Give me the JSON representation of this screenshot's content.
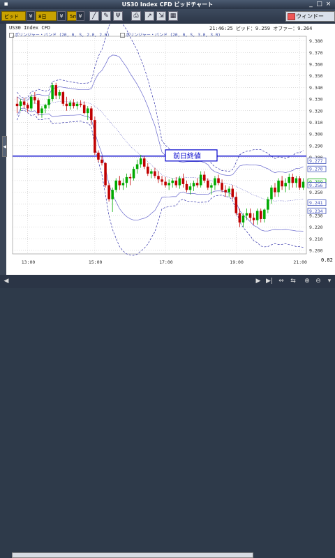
{
  "window": {
    "title": "US30 Index CFD ビッドチャート"
  },
  "toolbar": {
    "price_type": "ビッド",
    "period_count": "8日",
    "timeframe": "5m",
    "window_button": "ウィンドー"
  },
  "chart": {
    "symbol_label": "US30 Index CFD",
    "time": "21:46:25",
    "bid_label": "ビッド：9.259",
    "offer_label": "オファー：9.264",
    "legend1": "ボリンジャー・バンド (20, 0, S, 2.0, 2.0)",
    "legend2": "ボリンジャー・バンド (20, 0, S, 3.0, 3.0)",
    "prev_close_label": "前日終値",
    "zoom_readout": "0.82",
    "colors": {
      "up": "#00aa00",
      "down": "#c00000",
      "prev_close_line": "#0000cc",
      "band_inner": "#6666cc",
      "band_outer": "#3333aa"
    }
  },
  "chart_data": {
    "type": "candlestick",
    "x_ticks": [
      "13:00",
      "15:00",
      "17:00",
      "19:00",
      "21:00"
    ],
    "y_ticks": [
      "9.380",
      "9.370",
      "9.360",
      "9.350",
      "9.340",
      "9.330",
      "9.320",
      "9.310",
      "9.300",
      "9.290",
      "9.280",
      "9.270",
      "9.260",
      "9.250",
      "9.240",
      "9.230",
      "9.220",
      "9.210",
      "9.200"
    ],
    "ylim": [
      9.197,
      9.384
    ],
    "price_markers": [
      "9.277",
      "9.270",
      "9.259",
      "9.256",
      "9.241",
      "9.234"
    ],
    "prev_close": 9.281,
    "candles": [
      [
        9.326,
        9.332,
        9.318,
        9.324
      ],
      [
        9.324,
        9.33,
        9.32,
        9.328
      ],
      [
        9.328,
        9.331,
        9.322,
        9.325
      ],
      [
        9.325,
        9.327,
        9.319,
        9.322
      ],
      [
        9.322,
        9.334,
        9.32,
        9.332
      ],
      [
        9.332,
        9.336,
        9.326,
        9.329
      ],
      [
        9.329,
        9.331,
        9.316,
        9.318
      ],
      [
        9.318,
        9.324,
        9.314,
        9.322
      ],
      [
        9.322,
        9.326,
        9.318,
        9.325
      ],
      [
        9.325,
        9.333,
        9.322,
        9.33
      ],
      [
        9.33,
        9.344,
        9.328,
        9.342
      ],
      [
        9.342,
        9.344,
        9.33,
        9.333
      ],
      [
        9.333,
        9.338,
        9.33,
        9.336
      ],
      [
        9.336,
        9.337,
        9.324,
        9.326
      ],
      [
        9.326,
        9.332,
        9.32,
        9.324
      ],
      [
        9.324,
        9.329,
        9.321,
        9.327
      ],
      [
        9.327,
        9.33,
        9.322,
        9.324
      ],
      [
        9.324,
        9.328,
        9.321,
        9.326
      ],
      [
        9.326,
        9.329,
        9.323,
        9.325
      ],
      [
        9.325,
        9.328,
        9.317,
        9.318
      ],
      [
        9.318,
        9.324,
        9.312,
        9.322
      ],
      [
        9.322,
        9.324,
        9.308,
        9.312
      ],
      [
        9.312,
        9.315,
        9.282,
        9.284
      ],
      [
        9.284,
        9.286,
        9.276,
        9.278
      ],
      [
        9.278,
        9.281,
        9.273,
        9.275
      ],
      [
        9.275,
        9.276,
        9.254,
        9.256
      ],
      [
        9.256,
        9.258,
        9.242,
        9.244
      ],
      [
        9.244,
        9.254,
        9.233,
        9.252
      ],
      [
        9.252,
        9.262,
        9.25,
        9.26
      ],
      [
        9.26,
        9.264,
        9.252,
        9.256
      ],
      [
        9.256,
        9.262,
        9.252,
        9.258
      ],
      [
        9.258,
        9.266,
        9.254,
        9.263
      ],
      [
        9.263,
        9.266,
        9.256,
        9.262
      ],
      [
        9.262,
        9.272,
        9.26,
        9.27
      ],
      [
        9.27,
        9.278,
        9.266,
        9.274
      ],
      [
        9.274,
        9.282,
        9.271,
        9.279
      ],
      [
        9.279,
        9.281,
        9.27,
        9.272
      ],
      [
        9.272,
        9.275,
        9.264,
        9.266
      ],
      [
        9.266,
        9.27,
        9.262,
        9.268
      ],
      [
        9.268,
        9.271,
        9.262,
        9.264
      ],
      [
        9.264,
        9.268,
        9.258,
        9.261
      ],
      [
        9.261,
        9.264,
        9.256,
        9.259
      ],
      [
        9.259,
        9.263,
        9.254,
        9.256
      ],
      [
        9.256,
        9.261,
        9.252,
        9.258
      ],
      [
        9.258,
        9.262,
        9.254,
        9.26
      ],
      [
        9.26,
        9.263,
        9.254,
        9.256
      ],
      [
        9.256,
        9.264,
        9.253,
        9.262
      ],
      [
        9.262,
        9.266,
        9.254,
        9.257
      ],
      [
        9.257,
        9.26,
        9.25,
        9.252
      ],
      [
        9.252,
        9.258,
        9.248,
        9.255
      ],
      [
        9.255,
        9.26,
        9.251,
        9.258
      ],
      [
        9.258,
        9.262,
        9.254,
        9.256
      ],
      [
        9.256,
        9.268,
        9.254,
        9.265
      ],
      [
        9.265,
        9.268,
        9.258,
        9.26
      ],
      [
        9.26,
        9.262,
        9.252,
        9.254
      ],
      [
        9.254,
        9.258,
        9.248,
        9.256
      ],
      [
        9.256,
        9.264,
        9.252,
        9.262
      ],
      [
        9.262,
        9.265,
        9.256,
        9.258
      ],
      [
        9.258,
        9.261,
        9.25,
        9.252
      ],
      [
        9.252,
        9.256,
        9.246,
        9.25
      ],
      [
        9.25,
        9.255,
        9.246,
        9.253
      ],
      [
        9.253,
        9.256,
        9.244,
        9.246
      ],
      [
        9.246,
        9.25,
        9.23,
        9.232
      ],
      [
        9.232,
        9.236,
        9.22,
        9.224
      ],
      [
        9.224,
        9.232,
        9.22,
        9.23
      ],
      [
        9.23,
        9.236,
        9.226,
        9.232
      ],
      [
        9.232,
        9.236,
        9.225,
        9.228
      ],
      [
        9.228,
        9.232,
        9.222,
        9.226
      ],
      [
        9.226,
        9.236,
        9.222,
        9.234
      ],
      [
        9.234,
        9.236,
        9.224,
        9.227
      ],
      [
        9.227,
        9.236,
        9.224,
        9.235
      ],
      [
        9.235,
        9.246,
        9.232,
        9.244
      ],
      [
        9.244,
        9.256,
        9.24,
        9.254
      ],
      [
        9.254,
        9.258,
        9.246,
        9.25
      ],
      [
        9.25,
        9.262,
        9.246,
        9.26
      ],
      [
        9.26,
        9.264,
        9.252,
        9.255
      ],
      [
        9.255,
        9.262,
        9.25,
        9.258
      ],
      [
        9.258,
        9.266,
        9.252,
        9.263
      ],
      [
        9.263,
        9.266,
        9.254,
        9.258
      ],
      [
        9.258,
        9.264,
        9.254,
        9.262
      ],
      [
        9.262,
        9.264,
        9.252,
        9.254
      ],
      [
        9.254,
        9.262,
        9.252,
        9.259
      ]
    ]
  }
}
